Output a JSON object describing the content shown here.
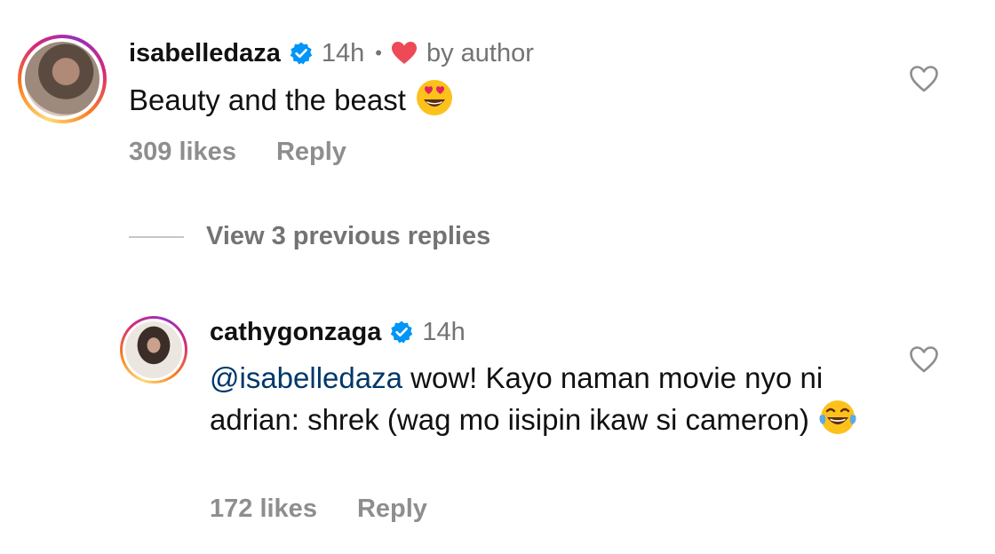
{
  "comments": [
    {
      "username": "isabelledaza",
      "time": "14h",
      "separator": "•",
      "by_author": "by author",
      "text": "Beauty and the beast",
      "likes": "309 likes",
      "reply": "Reply",
      "icons": {
        "verified": "verified-badge-icon",
        "heart": "red-heart-icon",
        "emoji": "heart-eyes-emoji",
        "like": "heart-outline-icon"
      }
    },
    {
      "username": "cathygonzaga",
      "time": "14h",
      "mention": "@isabelledaza",
      "text": " wow! Kayo naman movie nyo ni adrian: shrek (wag mo iisipin ikaw si cameron)",
      "likes": "172 likes",
      "reply": "Reply",
      "icons": {
        "verified": "verified-badge-icon",
        "emoji": "tears-of-joy-emoji",
        "like": "heart-outline-icon"
      }
    }
  ],
  "view_replies": "View 3 previous replies",
  "colors": {
    "verified": "#0095f6",
    "heart": "#ed4956",
    "mention": "#00376b",
    "muted": "#8e8e8e"
  }
}
